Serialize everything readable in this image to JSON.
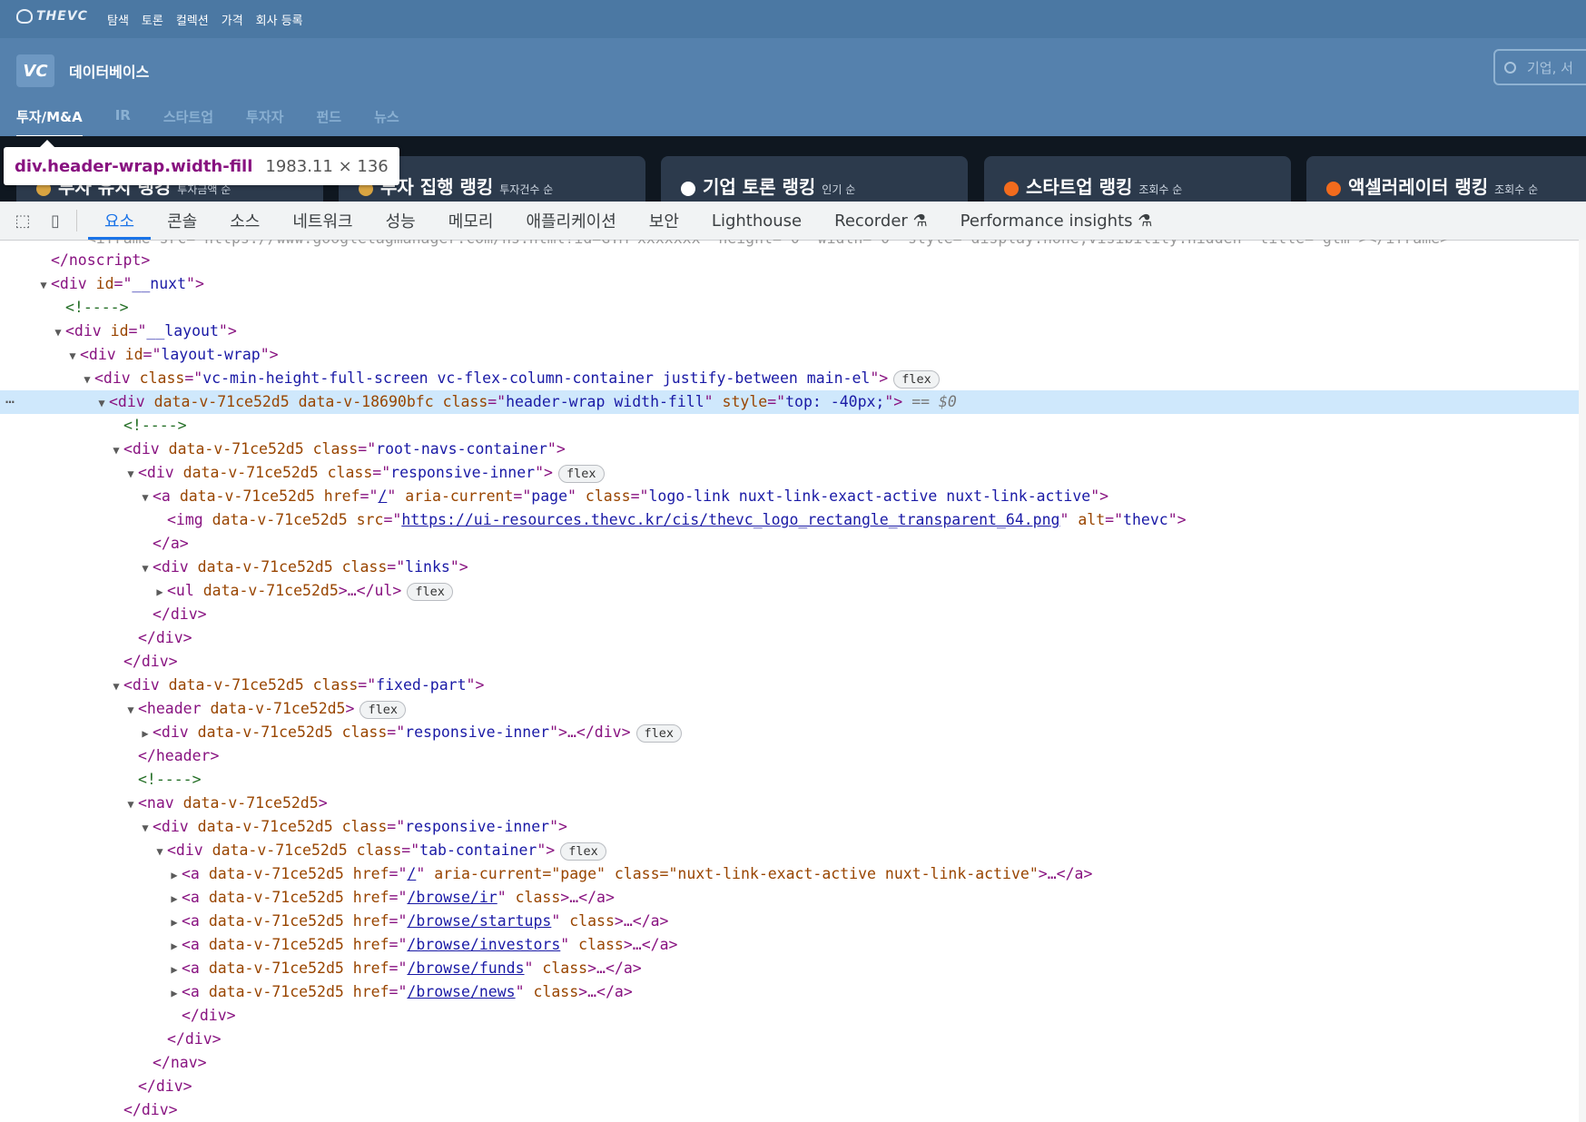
{
  "app": {
    "brand": "THEVC",
    "top_nav": [
      "탐색",
      "토론",
      "컬렉션",
      "가격",
      "회사 등록"
    ],
    "logo_text": "VC",
    "section_title": "데이터베이스",
    "search_placeholder": "기업, 서",
    "tabs": [
      "투자/M&A",
      "IR",
      "스타트업",
      "투자자",
      "펀드",
      "뉴스"
    ],
    "active_tab": "투자/M&A",
    "cards": [
      {
        "title": "투자 유치 랭킹",
        "sub": "투자금액 순"
      },
      {
        "title": "투자 집행 랭킹",
        "sub": "투자건수 순"
      },
      {
        "title": "기업 토론 랭킹",
        "sub": "인기 순"
      },
      {
        "title": "스타트업 랭킹",
        "sub": "조회수 순"
      },
      {
        "title": "액셀러레이터 랭킹",
        "sub": "조회수 순"
      }
    ]
  },
  "tooltip": {
    "selector": "div.header-wrap.width-fill",
    "dims": "1983.11 × 136"
  },
  "devtools": {
    "tabs": [
      "요소",
      "콘솔",
      "소스",
      "네트워크",
      "성능",
      "메모리",
      "애플리케이션",
      "보안",
      "Lighthouse",
      "Recorder ⚗",
      "Performance insights ⚗"
    ],
    "active_tab": "요소"
  },
  "tree": {
    "top_cut": "<iframe src=\"https://www.googletagmanager.com/ns.html?id=GTM-xxxxxxx\" height=\"0\" width=\"0\" style=\"display:none;visibility:hidden\" title=\"gtm\"></iframe>",
    "close_noscript": "</noscript>",
    "nuxt_id": "__nuxt",
    "comment": "<!---->",
    "layout_id": "__layout",
    "layout_wrap_id": "layout-wrap",
    "main_class": "vc-min-height-full-screen vc-flex-column-container justify-between main-el",
    "flex": "flex",
    "header_wrap": {
      "attr1": "data-v-71ce52d5",
      "attr2": "data-v-18690bfc",
      "class": "header-wrap width-fill",
      "style": "top: -40px;",
      "eq": "== $0"
    },
    "dv": "data-v-71ce52d5",
    "root_navs_class": "root-navs-container",
    "responsive_inner": "responsive-inner",
    "logo_href": "/",
    "aria_current": "page",
    "logo_class": "logo-link nuxt-link-exact-active nuxt-link-active",
    "img_src": "https://ui-resources.thevc.kr/cis/thevc_logo_rectangle_transparent_64.png",
    "img_alt": "thevc",
    "links_class": "links",
    "fixed_part_class": "fixed-part",
    "tab_container_class": "tab-container",
    "tab_links": [
      {
        "href": "/",
        "extra": " aria-current=\"page\" class=\"nuxt-link-exact-active nuxt-link-active\"",
        "link": false
      },
      {
        "href": "/browse/ir",
        "extra": " class",
        "link": true
      },
      {
        "href": "/browse/startups",
        "extra": " class",
        "link": true
      },
      {
        "href": "/browse/investors",
        "extra": " class",
        "link": true
      },
      {
        "href": "/browse/funds",
        "extra": " class",
        "link": true
      },
      {
        "href": "/browse/news",
        "extra": " class",
        "link": true
      }
    ]
  }
}
